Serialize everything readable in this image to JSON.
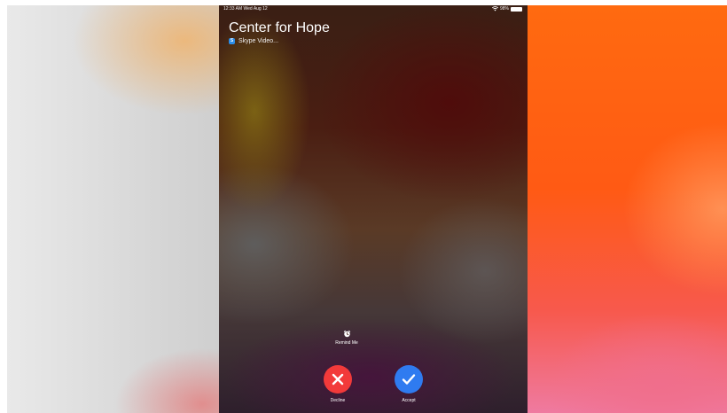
{
  "status_bar": {
    "time": "12:33 AM  Wed Aug 12",
    "battery": "98%",
    "wifi_icon": "wifi-icon",
    "battery_icon": "battery-icon"
  },
  "call": {
    "caller_name": "Center for Hope",
    "app_name": "Skype Video...",
    "app_icon": "skype-icon"
  },
  "actions": {
    "remind_label": "Remind Me",
    "remind_icon": "alarm-clock-icon",
    "decline_label": "Decline",
    "decline_icon": "close-icon",
    "accept_label": "Accept",
    "accept_icon": "checkmark-icon"
  },
  "colors": {
    "decline": "#f23a3a",
    "accept": "#2f7bf0",
    "skype": "#2b8de8"
  }
}
